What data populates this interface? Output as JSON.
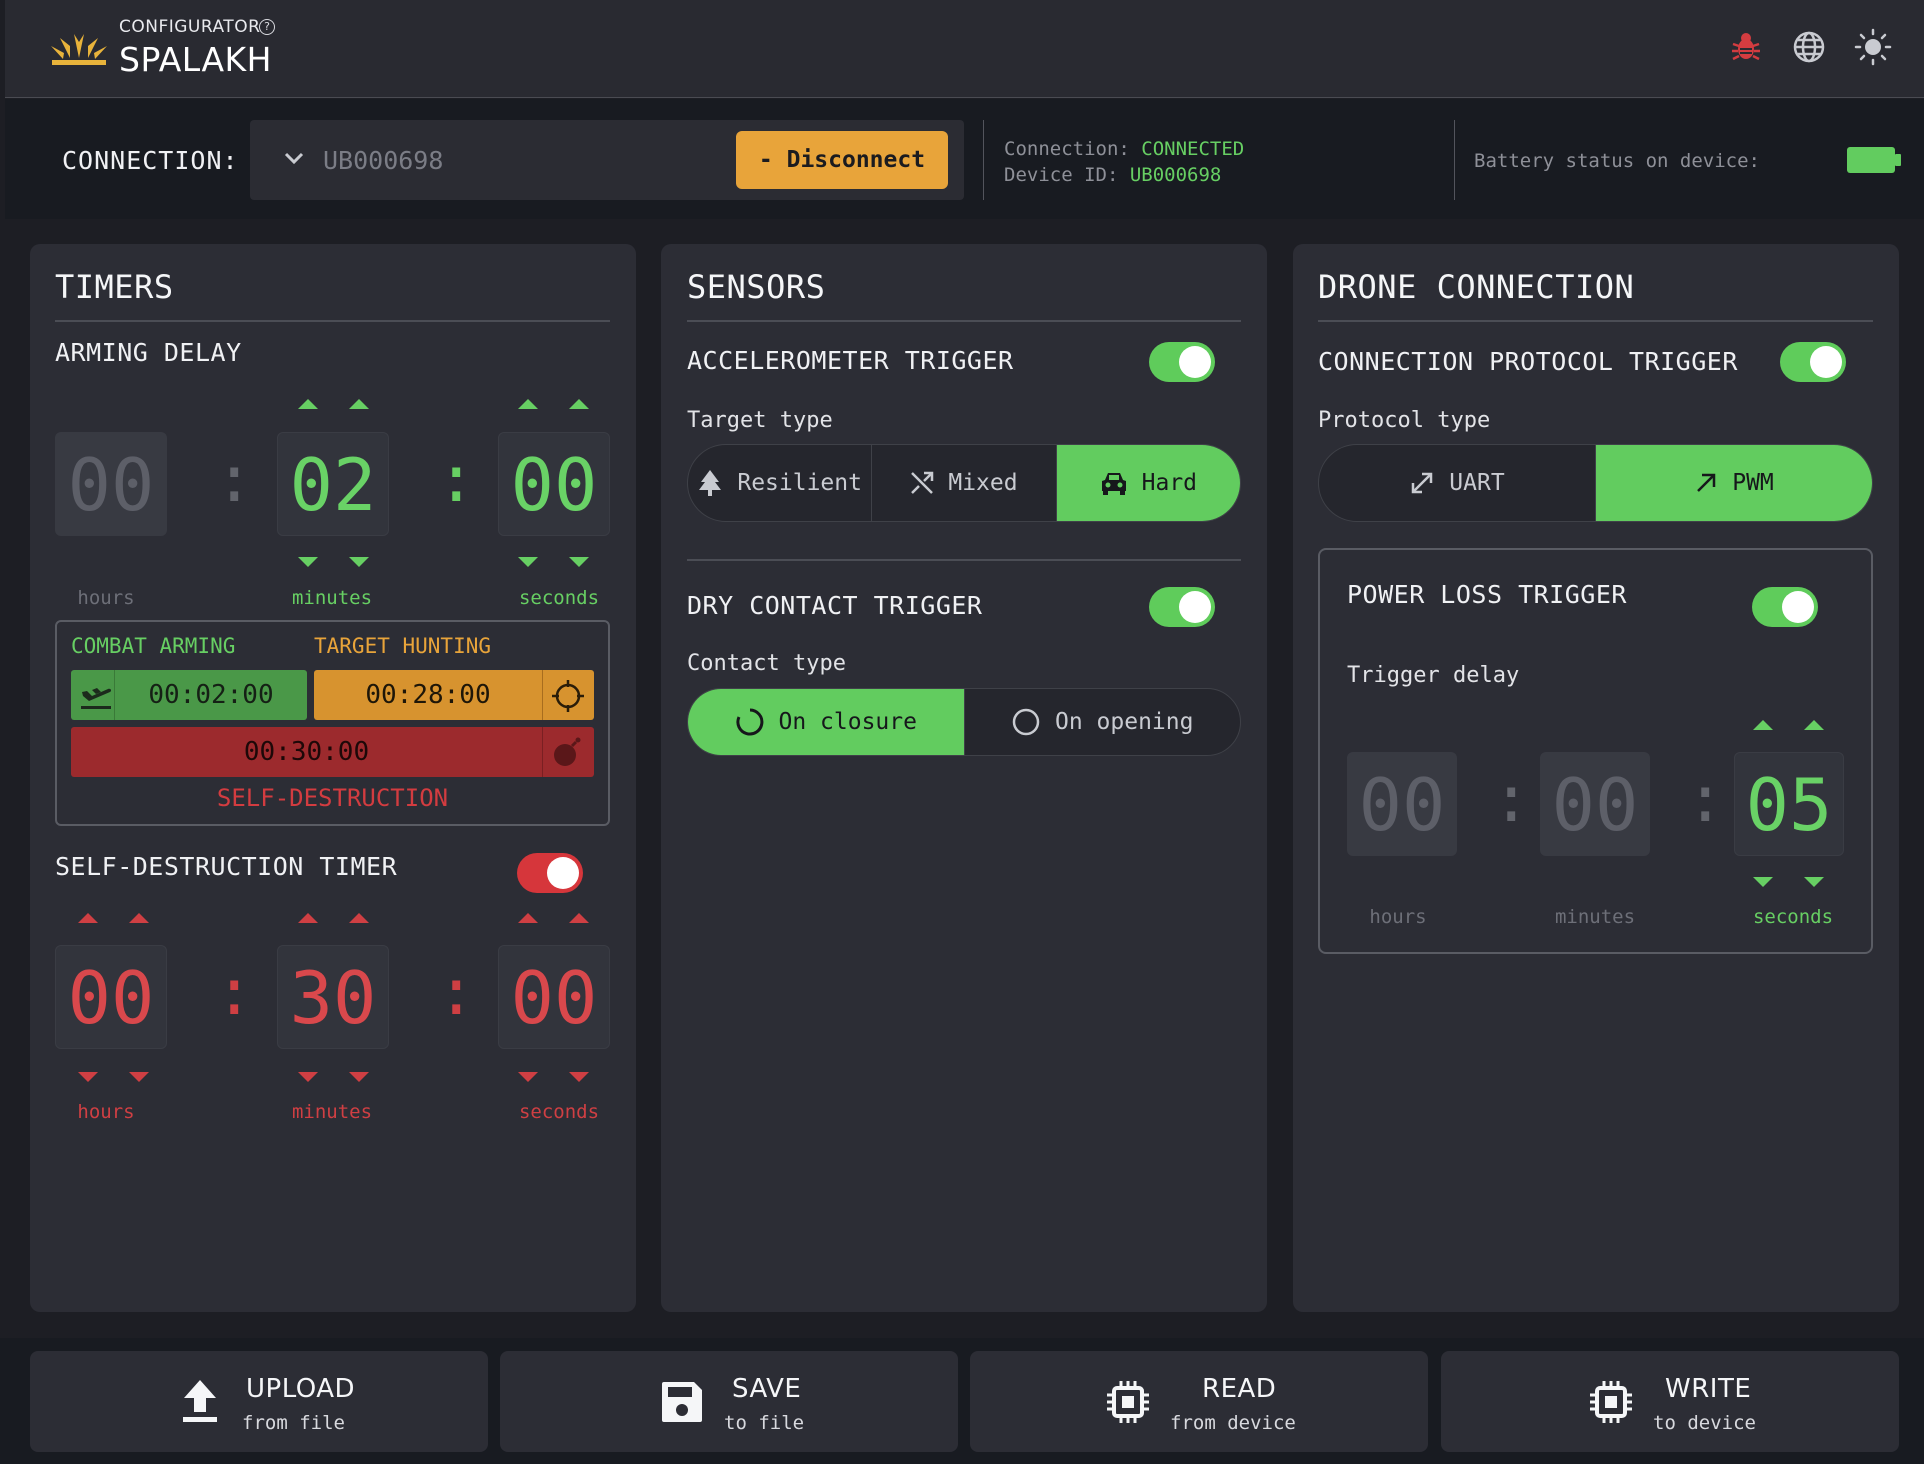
{
  "header": {
    "brand_small": "CONFIGURATOR",
    "brand_name": "SPALAKH",
    "help_glyph": "?",
    "icons": [
      "bug-icon",
      "globe-icon",
      "sun-icon"
    ]
  },
  "connection": {
    "label": "CONNECTION:",
    "selected_device": "UB000698",
    "disconnect_label": "- Disconnect",
    "status_label": "Connection:",
    "status_value": "CONNECTED",
    "device_id_label": "Device ID:",
    "device_id_value": "UB000698",
    "battery_label": "Battery status on device:"
  },
  "timers": {
    "title": "TIMERS",
    "arming_delay": {
      "title": "ARMING DELAY",
      "hours": "00",
      "minutes": "02",
      "seconds": "00",
      "hours_label": "hours",
      "minutes_label": "minutes",
      "seconds_label": "seconds"
    },
    "summary": {
      "combat_arming_label": "COMBAT ARMING",
      "target_hunting_label": "TARGET HUNTING",
      "combat_arming_time": "00:02:00",
      "target_hunting_time": "00:28:00",
      "self_destruction_time": "00:30:00",
      "self_destruction_label": "SELF-DESTRUCTION"
    },
    "self_destruction": {
      "title": "SELF-DESTRUCTION TIMER",
      "hours": "00",
      "minutes": "30",
      "seconds": "00",
      "hours_label": "hours",
      "minutes_label": "minutes",
      "seconds_label": "seconds"
    }
  },
  "sensors": {
    "title": "SENSORS",
    "accelerometer": {
      "title": "ACCELEROMETER TRIGGER",
      "type_label": "Target type",
      "options": [
        "Resilient",
        "Mixed",
        "Hard"
      ],
      "selected": "Hard"
    },
    "dry_contact": {
      "title": "DRY CONTACT TRIGGER",
      "type_label": "Contact type",
      "options": [
        "On closure",
        "On opening"
      ],
      "selected": "On closure"
    }
  },
  "drone": {
    "title": "DRONE CONNECTION",
    "protocol": {
      "title": "CONNECTION PROTOCOL TRIGGER",
      "type_label": "Protocol type",
      "options": [
        "UART",
        "PWM"
      ],
      "selected": "PWM"
    },
    "power_loss": {
      "title": "POWER LOSS TRIGGER",
      "delay_label": "Trigger delay",
      "hours": "00",
      "minutes": "00",
      "seconds": "05",
      "hours_label": "hours",
      "minutes_label": "minutes",
      "seconds_label": "seconds"
    }
  },
  "footer": {
    "upload_main": "UPLOAD",
    "upload_sub": "from file",
    "save_main": "SAVE",
    "save_sub": "to file",
    "read_main": "READ",
    "read_sub": "from device",
    "write_main": "WRITE",
    "write_sub": "to device"
  },
  "colors": {
    "accent_green": "#62cc5f",
    "accent_orange": "#e8a43a",
    "accent_red": "#d6363b",
    "panel_bg": "#2c2d35"
  }
}
